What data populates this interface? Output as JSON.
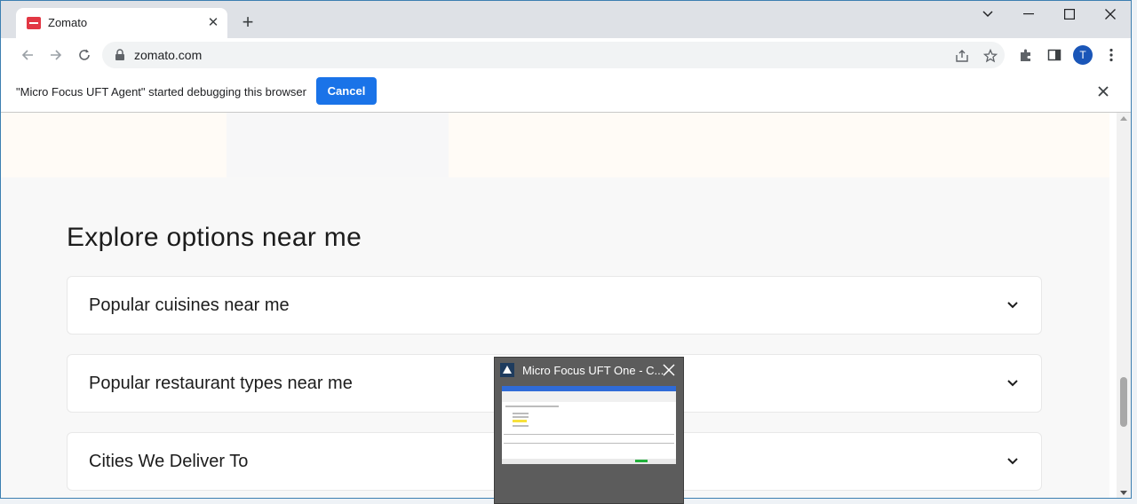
{
  "browser": {
    "tab_title": "Zomato",
    "url": "zomato.com",
    "avatar_initial": "T"
  },
  "infobar": {
    "message": "\"Micro Focus UFT Agent\" started debugging this browser",
    "cancel_label": "Cancel"
  },
  "page": {
    "heading": "Explore options near me",
    "accordions": [
      {
        "label": "Popular cuisines near me"
      },
      {
        "label": "Popular restaurant types near me"
      },
      {
        "label": "Cities We Deliver To"
      }
    ]
  },
  "taskbar_preview": {
    "title": "Micro Focus UFT One - C..."
  },
  "colors": {
    "brand": "#e23744",
    "cancel_button": "#1a73e8",
    "avatar": "#1a56b8"
  }
}
